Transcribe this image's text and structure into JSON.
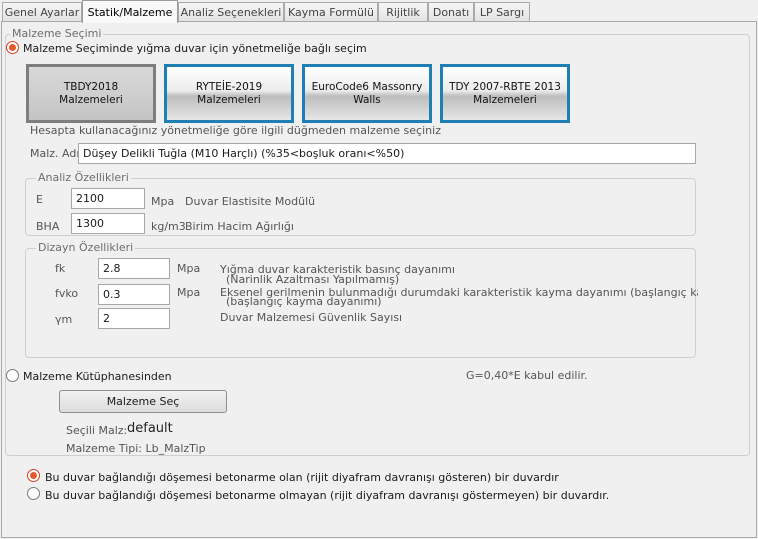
{
  "tabs": [
    {
      "label": "Genel Ayarlar",
      "active": false
    },
    {
      "label": "Statik/Malzeme",
      "active": true
    },
    {
      "label": "Analiz Seçenekleri",
      "active": false
    },
    {
      "label": "Kayma Formülü",
      "active": false
    },
    {
      "label": "Rijitlik",
      "active": false
    },
    {
      "label": "Donatı",
      "active": false
    },
    {
      "label": "LP Sargı",
      "active": false
    }
  ],
  "material_selection": {
    "group_label": "Malzeme Seçimi",
    "option_regulation": {
      "label": "Malzeme Seçiminde yığma duvar için yönetmeliğe bağlı seçim",
      "checked": true
    },
    "regulation_buttons": [
      {
        "label": "TBDY2018 Malzemeleri",
        "pressed": true
      },
      {
        "label": "RYTEİE-2019 Malzemeleri",
        "pressed": false
      },
      {
        "label": "EuroCode6 Massonry Walls",
        "pressed": false
      },
      {
        "label": "TDY 2007-RBTE 2013 Malzemeleri",
        "pressed": false
      }
    ],
    "hint": "Hesapta kullanacağınız yönetmeliğe göre ilgili düğmeden malzeme seçiniz",
    "material_name_label": "Malz. Adı",
    "material_name_value": "Düşey Delikli Tuğla (M10 Harçlı)  (%35<boşluk oranı<%50)"
  },
  "analysis": {
    "group_label": "Analiz Özellikleri",
    "E": {
      "label": "E",
      "value": "2100",
      "unit": "Mpa",
      "desc": "Duvar Elastisite Modülü"
    },
    "BHA": {
      "label": "BHA",
      "value": "1300",
      "unit": "kg/m3",
      "desc": "Birim Hacim Ağırlığı"
    }
  },
  "design": {
    "group_label": "Dizayn Özellikleri",
    "fk": {
      "label": "fk",
      "value": "2.8",
      "unit": "Mpa",
      "desc1": "Yığma duvar karakteristik basınç dayanımı",
      "desc2": "(Narinlik Azaltması Yapılmamış)"
    },
    "fvko": {
      "label": "fvko",
      "value": "0.3",
      "unit": "Mpa",
      "desc1": "Eksenel gerilmenin bulunmadığı durumdaki karakteristik kayma dayanımı (başlangıç kayma",
      "desc2": "(başlangıç kayma dayanımı)"
    },
    "ym": {
      "label": "γm",
      "value": "2",
      "desc": "Duvar Malzemesi Güvenlik Sayısı"
    }
  },
  "library": {
    "option": {
      "label": "Malzeme Kütüphanesinden",
      "checked": false
    },
    "g_note": "G=0,40*E kabul edilir.",
    "select_button": "Malzeme Seç",
    "selected_label": "Seçili Malz:",
    "selected_value": "default",
    "type_label": "Malzeme Tipi: Lb_MalzTip"
  },
  "floor_options": [
    {
      "label": "Bu duvar bağlandığı döşemesi betonarme olan  (rijit diyafram davranışı gösteren) bir duvardır",
      "checked": true
    },
    {
      "label": "Bu duvar bağlandığı döşemesi betonarme olmayan (rijit diyafram davranışı göstermeyen) bir duvardır.",
      "checked": false
    }
  ],
  "colors": {
    "accent": "#1f7fb4",
    "radio": "#e4582e"
  }
}
